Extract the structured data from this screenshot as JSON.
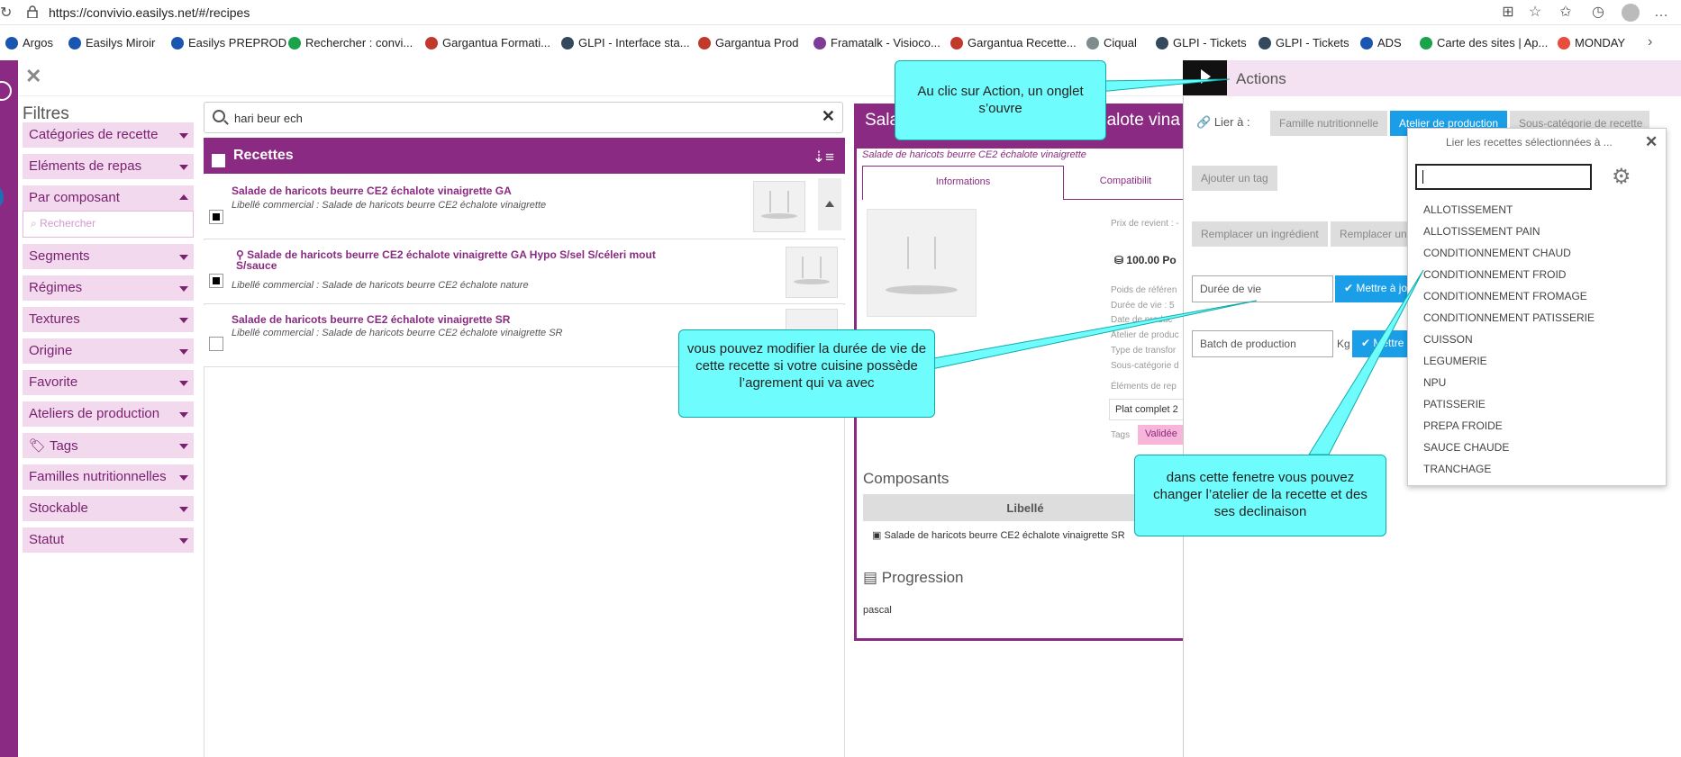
{
  "browser": {
    "url": "https://convivio.easilys.net/#/recipes"
  },
  "bookmarks": [
    {
      "label": "Argos",
      "color": "#1a56b0"
    },
    {
      "label": "Easilys Miroir",
      "color": "#1a56b0"
    },
    {
      "label": "Easilys PREPROD",
      "color": "#1a56b0"
    },
    {
      "label": "Rechercher : convi...",
      "color": "#1aa34a"
    },
    {
      "label": "Gargantua Formati...",
      "color": "#c0392b"
    },
    {
      "label": "GLPI - Interface sta...",
      "color": "#34495e"
    },
    {
      "label": "Gargantua Prod",
      "color": "#c0392b"
    },
    {
      "label": "Framatalk - Visioco...",
      "color": "#7d3c98"
    },
    {
      "label": "Gargantua Recette...",
      "color": "#c0392b"
    },
    {
      "label": "Ciqual",
      "color": "#7f8c8d"
    },
    {
      "label": "GLPI - Tickets",
      "color": "#34495e"
    },
    {
      "label": "GLPI - Tickets",
      "color": "#34495e"
    },
    {
      "label": "ADS",
      "color": "#1a56b0"
    },
    {
      "label": "Carte des sites | Ap...",
      "color": "#1aa34a"
    },
    {
      "label": "MONDAY",
      "color": "#e74c3c"
    }
  ],
  "filters": {
    "title": "Filtres",
    "search_placeholder": "Rechercher",
    "items": [
      "Catégories de recette",
      "Eléments de repas",
      "Par composant",
      "Segments",
      "Régimes",
      "Textures",
      "Origine",
      "Favorite",
      "Ateliers de production",
      "Tags",
      "Familles nutritionnelles",
      "Stockable",
      "Statut"
    ]
  },
  "search": {
    "value": "hari beur ech"
  },
  "recipes": {
    "title": "Recettes",
    "rows": [
      {
        "name": "Salade de haricots beurre CE2 échalote vinaigrette GA",
        "label": "Libellé commercial : Salade de haricots beurre CE2 échalote vinaigrette"
      },
      {
        "name": "Salade de haricots beurre CE2 échalote vinaigrette GA Hypo S/sel S/céleri mout S/sauce",
        "label": "Libellé commercial : Salade de haricots beurre CE2 échalote nature"
      },
      {
        "name": "Salade de haricots beurre CE2 échalote vinaigrette SR",
        "label": "Libellé commercial : Salade de haricots beurre CE2 échalote vinaigrette SR"
      }
    ]
  },
  "detail": {
    "title_left": "Sala",
    "title_right": "halote vina",
    "subtitle": "Salade de haricots beurre CE2 échalote vinaigrette",
    "tab_info": "Informations",
    "tab_compat": "Compatibilit",
    "prix": "Prix de revient : -",
    "price": "100.00 Po",
    "poids": "Poids de référen",
    "duree": "Durée de vie : 5",
    "pr1": "Date de produc",
    "pr2": "Atelier de produc",
    "pr3": "Type de transfor",
    "pr4": "Sous-catégorie d",
    "elements": "Éléments de rep",
    "plat": "Plat complet 2",
    "tags_label": "Tags",
    "tag_value": "Validée",
    "composants": "Composants",
    "libelle": "Libellé",
    "compo_row": "Salade de haricots beurre CE2 échalote vinaigrette SR",
    "progression": "Progression",
    "progression_value": "pascal"
  },
  "actions": {
    "title": "Actions",
    "lier": "Lier à :",
    "famille": "Famille nutritionnelle",
    "atelier": "Atelier de production",
    "souscat": "Sous-catégorie de recette",
    "ajouter_tag": "Ajouter un tag",
    "remplacer_ing": "Remplacer un ingrédient",
    "remplacer_un": "Remplacer un",
    "duree_placeholder": "Durée de vie",
    "mettre_a_jour": "✔ Mettre à jo",
    "batch_placeholder": "Batch de production",
    "unit": "Kg",
    "mettre": "✔ Mettre"
  },
  "dropdown": {
    "title": "Lier les recettes sélectionnées à ...",
    "options": [
      "ALLOTISSEMENT",
      "ALLOTISSEMENT PAIN",
      "CONDITIONNEMENT CHAUD",
      "CONDITIONNEMENT FROID",
      "CONDITIONNEMENT FROMAGE",
      "CONDITIONNEMENT PATISSERIE",
      "CUISSON",
      "LEGUMERIE",
      "NPU",
      "PATISSERIE",
      "PREPA FROIDE",
      "SAUCE CHAUDE",
      "TRANCHAGE"
    ]
  },
  "callouts": {
    "action": "Au clic sur Action, un onglet s’ouvre",
    "duree": "vous pouvez modifier la durée de vie de cette recette si votre cuisine possède l’agrement qui va avec",
    "atelier": "dans cette fenetre vous pouvez changer l’atelier de la recette et des ses declinaison"
  }
}
